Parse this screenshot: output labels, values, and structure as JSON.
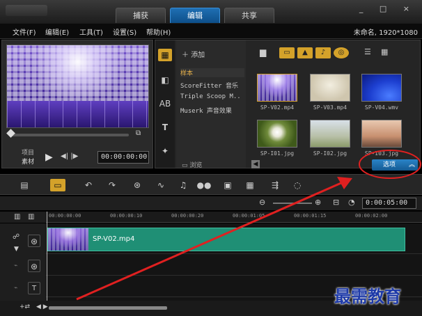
{
  "tabs": [
    "捕获",
    "编辑",
    "共享"
  ],
  "window_controls": "_ □ ×",
  "menu": [
    "文件(F)",
    "编辑(E)",
    "工具(T)",
    "设置(S)",
    "帮助(H)"
  ],
  "project_info": "未命名, 1920*1080",
  "preview": {
    "mode_project": "项目",
    "mode_clip": "素材",
    "timecode": "00:00:00:00"
  },
  "library": {
    "add_label": "添加",
    "items": [
      "样本",
      "ScoreFitter 音乐",
      "Triple Scoop M..",
      "Muserk 声音效果"
    ],
    "browse_label": "浏览",
    "options_label": "选项",
    "thumbnails": [
      "SP-V02.mp4",
      "SP-V03.mp4",
      "SP-V04.wmv",
      "SP-I01.jpg",
      "SP-I02.jpg",
      "SP-I03.jpg"
    ]
  },
  "timeline": {
    "zoom_timecode": "0:00:05:00",
    "ruler_ticks": [
      "00:00:00:00",
      "00:00:00:10",
      "00:00:00:20",
      "00:00:01:05",
      "00:00:01:15",
      "00:00:02:00"
    ],
    "clip_label": "SP-V02.mp4"
  },
  "watermark": "最需教育",
  "colors": {
    "accent": "#d4a22a",
    "active_tab": "#1f6fb3",
    "clip": "#1f8f75",
    "annotation": "#e02020"
  }
}
